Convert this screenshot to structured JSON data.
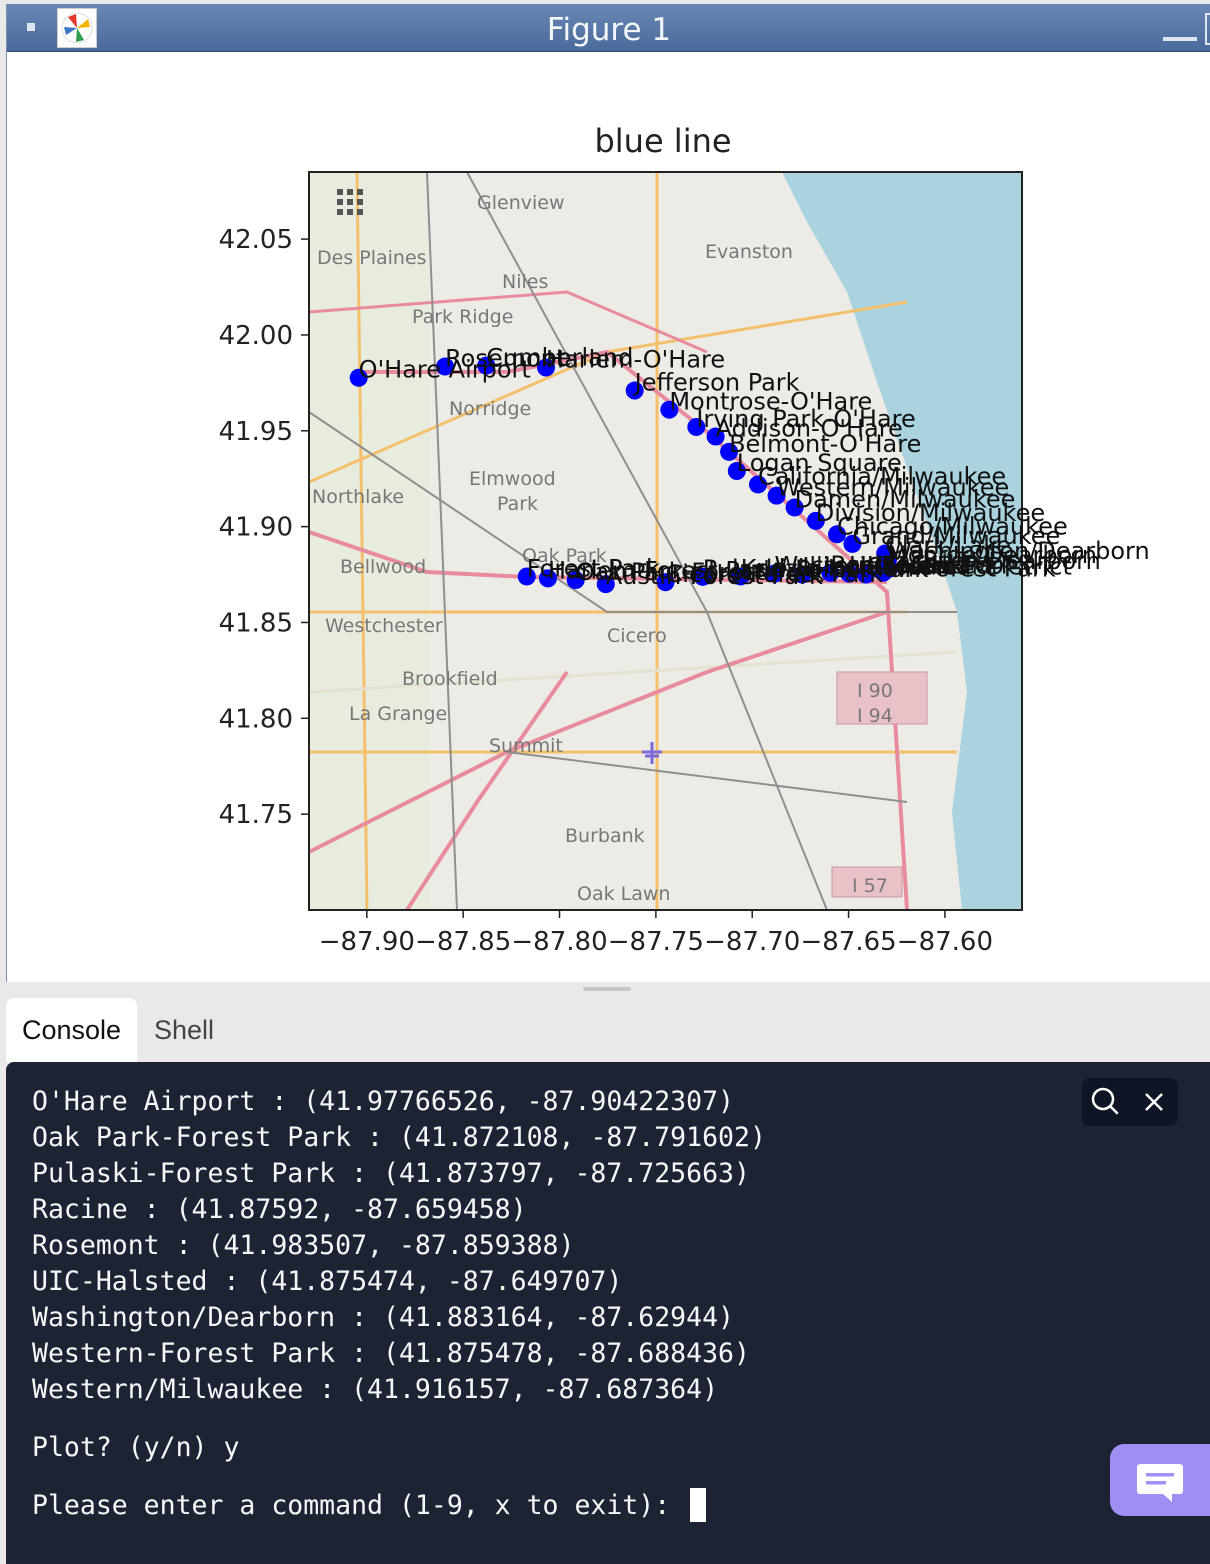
{
  "window": {
    "title": "Figure 1"
  },
  "chart_data": {
    "type": "scatter",
    "title": "blue line",
    "xlim": [
      -87.93,
      -87.56
    ],
    "ylim": [
      41.7,
      42.085
    ],
    "xticks": [
      "-87.90",
      "-87.85",
      "-87.80",
      "-87.75",
      "-87.70",
      "-87.65",
      "-87.60"
    ],
    "yticks": [
      "42.05",
      "42.00",
      "41.95",
      "41.90",
      "41.85",
      "41.80",
      "41.75"
    ],
    "background": "street map of Chicago area",
    "map_labels": [
      "Glenview",
      "Evanston",
      "Des Plaines",
      "Niles",
      "Park Ridge",
      "Norridge",
      "Elmwood",
      "Park",
      "Northlake",
      "Bellwood",
      "Oak Park",
      "Westchester",
      "Cicero",
      "Brookfield",
      "La Grange",
      "Summit",
      "Burbank",
      "Oak Lawn",
      "I 90",
      "I 94",
      "I 57"
    ],
    "point_color": "#0000ff",
    "points": [
      {
        "name": "O'Hare Airport",
        "x": -87.90422307,
        "y": 41.97766526
      },
      {
        "name": "Rosemont",
        "x": -87.859388,
        "y": 41.983507
      },
      {
        "name": "Cumberland",
        "x": -87.838,
        "y": 41.984
      },
      {
        "name": "Harlem-O'Hare",
        "x": -87.807,
        "y": 41.983
      },
      {
        "name": "Jefferson Park",
        "x": -87.761,
        "y": 41.971
      },
      {
        "name": "Montrose-O'Hare",
        "x": -87.743,
        "y": 41.961
      },
      {
        "name": "Irving Park-O'Hare",
        "x": -87.729,
        "y": 41.952
      },
      {
        "name": "Addison-O'Hare",
        "x": -87.719,
        "y": 41.947
      },
      {
        "name": "Belmont-O'Hare",
        "x": -87.712,
        "y": 41.939
      },
      {
        "name": "Logan Square",
        "x": -87.708,
        "y": 41.929
      },
      {
        "name": "California/Milwaukee",
        "x": -87.697,
        "y": 41.922
      },
      {
        "name": "Western/Milwaukee",
        "x": -87.687364,
        "y": 41.916157
      },
      {
        "name": "Damen/Milwaukee",
        "x": -87.678,
        "y": 41.91
      },
      {
        "name": "Division/Milwaukee",
        "x": -87.667,
        "y": 41.903
      },
      {
        "name": "Chicago/Milwaukee",
        "x": -87.656,
        "y": 41.896
      },
      {
        "name": "Grand/Milwaukee",
        "x": -87.648,
        "y": 41.891
      },
      {
        "name": "Clark/Lake",
        "x": -87.631,
        "y": 41.886
      },
      {
        "name": "Washington/Dearborn",
        "x": -87.62944,
        "y": 41.883164
      },
      {
        "name": "Monroe/Dearborn",
        "x": -87.63,
        "y": 41.881
      },
      {
        "name": "Jackson/Dearborn",
        "x": -87.629,
        "y": 41.878
      },
      {
        "name": "LaSalle",
        "x": -87.632,
        "y": 41.876
      },
      {
        "name": "Clinton",
        "x": -87.641,
        "y": 41.875
      },
      {
        "name": "UIC-Halsted",
        "x": -87.649707,
        "y": 41.875474
      },
      {
        "name": "Racine",
        "x": -87.659458,
        "y": 41.87592
      },
      {
        "name": "Illinois Medical District",
        "x": -87.674,
        "y": 41.875
      },
      {
        "name": "Western-Forest Park",
        "x": -87.688436,
        "y": 41.875478
      },
      {
        "name": "Kedzie-Homan-Forest Park",
        "x": -87.706,
        "y": 41.874
      },
      {
        "name": "Pulaski-Forest Park",
        "x": -87.725663,
        "y": 41.873797
      },
      {
        "name": "Cicero-Forest Park",
        "x": -87.745,
        "y": 41.871
      },
      {
        "name": "Austin-Forest Park",
        "x": -87.776,
        "y": 41.87
      },
      {
        "name": "Oak Park-Forest Park",
        "x": -87.791602,
        "y": 41.872108
      },
      {
        "name": "Harlem-Forest Park",
        "x": -87.806,
        "y": 41.873
      },
      {
        "name": "Forest Park",
        "x": -87.817,
        "y": 41.874
      }
    ]
  },
  "tabs": {
    "console": "Console",
    "shell": "Shell"
  },
  "console": {
    "lines": [
      "O'Hare Airport : (41.97766526, -87.90422307)",
      "Oak Park-Forest Park : (41.872108, -87.791602)",
      "Pulaski-Forest Park : (41.873797, -87.725663)",
      "Racine : (41.87592, -87.659458)",
      "Rosemont : (41.983507, -87.859388)",
      "UIC-Halsted : (41.875474, -87.649707)",
      "Washington/Dearborn : (41.883164, -87.62944)",
      "Western-Forest Park : (41.875478, -87.688436)",
      "Western/Milwaukee : (41.916157, -87.687364)"
    ],
    "plot_prompt": "Plot? (y/n) y",
    "command_prompt": "Please enter a command (1-9, x to exit): "
  },
  "icons": {
    "search": "search-icon",
    "close": "close-icon",
    "chat": "chat-icon",
    "app": "matplotlib-icon"
  }
}
